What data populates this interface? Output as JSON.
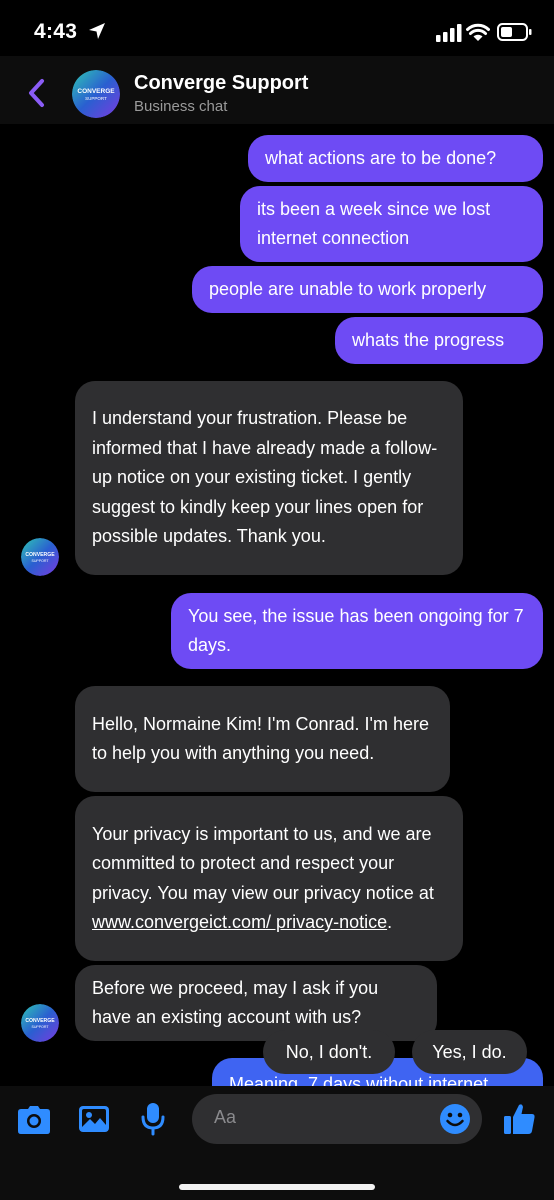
{
  "status_bar": {
    "time": "4:43"
  },
  "header": {
    "title": "Converge Support",
    "subtitle": "Business chat",
    "avatar_text_top": "CONVERGE",
    "avatar_text_bottom": "SUPPORT"
  },
  "messages": [
    {
      "side": "out",
      "text": "what actions are to be done?"
    },
    {
      "side": "out",
      "text": "its been a week since we lost internet connection"
    },
    {
      "side": "out",
      "text": "people are unable to work properly"
    },
    {
      "side": "out",
      "text": "whats the progress"
    },
    {
      "side": "in",
      "text": "I understand your frustration. Please be informed that I have already made a follow-up notice on your existing ticket. I gently suggest to kindly keep your lines open for possible updates. Thank you."
    },
    {
      "side": "out",
      "text": "You see, the issue has been ongoing for 7 days."
    },
    {
      "side": "in",
      "text": "Hello, Normaine Kim! I'm Conrad. I'm here to help you with anything you need."
    },
    {
      "side": "in",
      "text_before_link": "Your privacy is important to us, and we are committed to protect and respect your privacy. You may view our privacy notice at ",
      "link_text": "www.convergeict.com/ privacy-notice",
      "text_after_link": "."
    },
    {
      "side": "in",
      "text": "Before we proceed, may I ask if you have an existing account with us?"
    },
    {
      "side": "out",
      "text": "Meaning, 7 days without internet"
    }
  ],
  "quick_replies": [
    "No, I don't.",
    "Yes, I do."
  ],
  "composer": {
    "placeholder": "Aa"
  },
  "colors": {
    "outgoing": "#6e4bf4",
    "incoming": "#2f2f31",
    "accent": "#2f8cff",
    "back": "#8a5cf6"
  },
  "icons": [
    "back-chevron-icon",
    "camera-icon",
    "photo-icon",
    "microphone-icon",
    "emoji-icon",
    "thumbs-up-icon"
  ]
}
